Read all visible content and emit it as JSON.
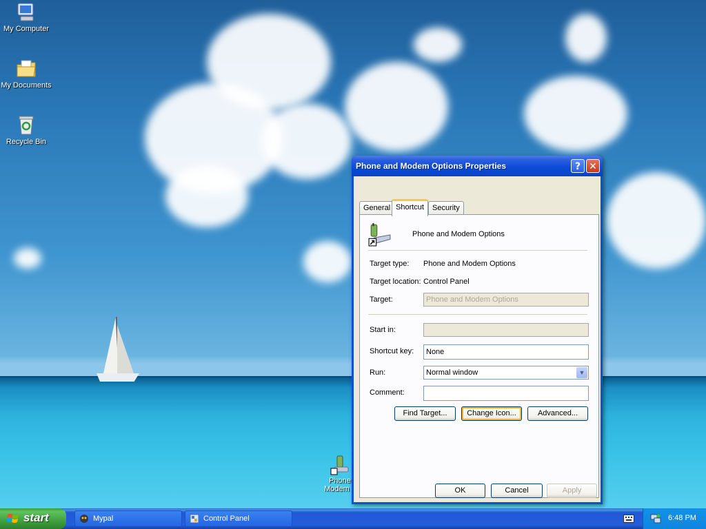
{
  "desktop": {
    "icons": [
      {
        "label": "My Computer",
        "icon": "my-computer-icon"
      },
      {
        "label": "My Documents",
        "icon": "my-documents-icon"
      },
      {
        "label": "Recycle Bin",
        "icon": "recycle-bin-icon"
      }
    ],
    "shortcut_label_line1": "Phone",
    "shortcut_label_line2": "Modem o"
  },
  "dialog": {
    "title": "Phone and Modem Options Properties",
    "help_glyph": "?",
    "close_glyph": "✕",
    "tabs": [
      {
        "label": "General",
        "active": false
      },
      {
        "label": "Shortcut",
        "active": true
      },
      {
        "label": "Security",
        "active": false
      }
    ],
    "shortcut_name": "Phone and Modem Options",
    "target_type_label": "Target type:",
    "target_type_value": "Phone and Modem Options",
    "target_location_label": "Target location:",
    "target_location_value": "Control Panel",
    "target_label": "Target:",
    "target_value": "Phone and Modem Options",
    "start_in_label": "Start in:",
    "start_in_value": "",
    "shortcut_key_label": "Shortcut key:",
    "shortcut_key_value": "None",
    "run_label": "Run:",
    "run_value": "Normal window",
    "comment_label": "Comment:",
    "comment_value": "",
    "find_target_button": "Find Target...",
    "change_icon_button": "Change Icon...",
    "advanced_button": "Advanced...",
    "ok_button": "OK",
    "cancel_button": "Cancel",
    "apply_button": "Apply"
  },
  "taskbar": {
    "start_label": "start",
    "tasks": [
      {
        "label": "Mypal",
        "icon": "mypal-icon"
      },
      {
        "label": "Control Panel",
        "icon": "control-panel-icon"
      }
    ],
    "clock": "6:48 PM"
  },
  "colors": {
    "title_bar": "#0a4ad5",
    "start_button": "#3a9a3a",
    "taskbar": "#245edb",
    "dialog_face": "#ece9d8"
  }
}
